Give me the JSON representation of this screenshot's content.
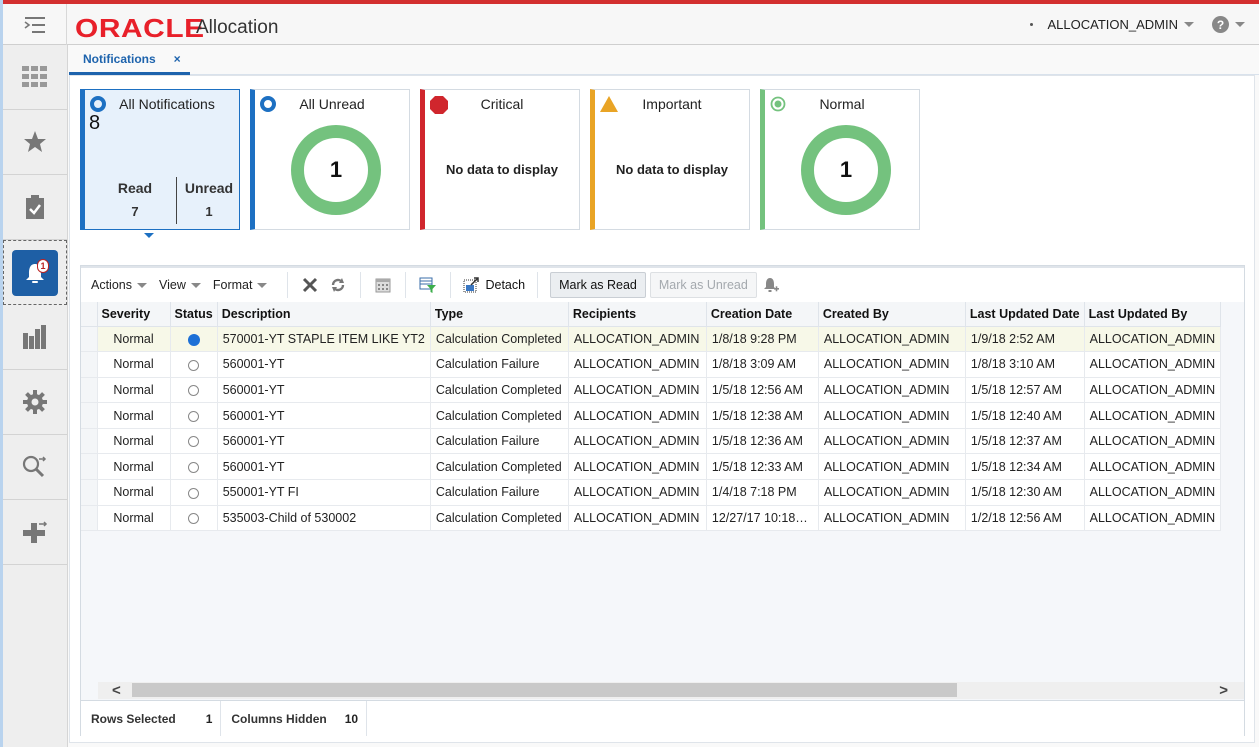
{
  "header": {
    "logo": "ORACLE",
    "app_name": "Allocation",
    "user": "ALLOCATION_ADMIN",
    "help_glyph": "?"
  },
  "leftnav": {
    "items": [
      {
        "name": "tasks-grid-icon"
      },
      {
        "name": "favorites-star-icon"
      },
      {
        "name": "clipboard-check-icon"
      },
      {
        "name": "notifications-bell-icon",
        "badge": "1",
        "active": true
      },
      {
        "name": "reports-bar-chart-icon"
      },
      {
        "name": "settings-gear-icon"
      },
      {
        "name": "search-navigate-icon"
      },
      {
        "name": "create-new-icon"
      }
    ]
  },
  "tabs": [
    {
      "label": "Notifications",
      "close": "×"
    }
  ],
  "tiles": {
    "all_notifications": {
      "title": "All Notifications",
      "count": "8",
      "read_label": "Read",
      "read_value": "7",
      "unread_label": "Unread",
      "unread_value": "1"
    },
    "all_unread": {
      "title": "All Unread",
      "value": "1"
    },
    "critical": {
      "title": "Critical",
      "message": "No data to display",
      "color": "#d0262d"
    },
    "important": {
      "title": "Important",
      "message": "No data to display",
      "color": "#e9a425"
    },
    "normal": {
      "title": "Normal",
      "value": "1",
      "color": "#74c27e"
    }
  },
  "toolbar": {
    "actions": "Actions",
    "view": "View",
    "format": "Format",
    "detach": "Detach",
    "mark_read": "Mark as Read",
    "mark_unread": "Mark as Unread"
  },
  "table": {
    "columns": [
      "Severity",
      "Status",
      "Description",
      "Type",
      "Recipients",
      "Creation Date",
      "Created By",
      "Last Updated Date",
      "Last Updated By"
    ],
    "rows": [
      {
        "severity": "Normal",
        "status": "unread",
        "description": "570001-YT STAPLE ITEM LIKE YT2",
        "type": "Calculation Completed",
        "recipients": "ALLOCATION_ADMIN",
        "created": "1/8/18 9:28 PM",
        "created_by": "ALLOCATION_ADMIN",
        "updated": "1/9/18 2:52 AM",
        "updated_by": "ALLOCATION_ADMIN",
        "selected": true
      },
      {
        "severity": "Normal",
        "status": "read",
        "description": "560001-YT",
        "type": "Calculation Failure",
        "recipients": "ALLOCATION_ADMIN",
        "created": "1/8/18 3:09 AM",
        "created_by": "ALLOCATION_ADMIN",
        "updated": "1/8/18 3:10 AM",
        "updated_by": "ALLOCATION_ADMIN"
      },
      {
        "severity": "Normal",
        "status": "read",
        "description": "560001-YT",
        "type": "Calculation Completed",
        "recipients": "ALLOCATION_ADMIN",
        "created": "1/5/18 12:56 AM",
        "created_by": "ALLOCATION_ADMIN",
        "updated": "1/5/18 12:57 AM",
        "updated_by": "ALLOCATION_ADMIN"
      },
      {
        "severity": "Normal",
        "status": "read",
        "description": "560001-YT",
        "type": "Calculation Completed",
        "recipients": "ALLOCATION_ADMIN",
        "created": "1/5/18 12:38 AM",
        "created_by": "ALLOCATION_ADMIN",
        "updated": "1/5/18 12:40 AM",
        "updated_by": "ALLOCATION_ADMIN"
      },
      {
        "severity": "Normal",
        "status": "read",
        "description": "560001-YT",
        "type": "Calculation Failure",
        "recipients": "ALLOCATION_ADMIN",
        "created": "1/5/18 12:36 AM",
        "created_by": "ALLOCATION_ADMIN",
        "updated": "1/5/18 12:37 AM",
        "updated_by": "ALLOCATION_ADMIN"
      },
      {
        "severity": "Normal",
        "status": "read",
        "description": "560001-YT",
        "type": "Calculation Completed",
        "recipients": "ALLOCATION_ADMIN",
        "created": "1/5/18 12:33 AM",
        "created_by": "ALLOCATION_ADMIN",
        "updated": "1/5/18 12:34 AM",
        "updated_by": "ALLOCATION_ADMIN"
      },
      {
        "severity": "Normal",
        "status": "read",
        "description": "550001-YT FI",
        "type": "Calculation Failure",
        "recipients": "ALLOCATION_ADMIN",
        "created": "1/4/18 7:18 PM",
        "created_by": "ALLOCATION_ADMIN",
        "updated": "1/5/18 12:30 AM",
        "updated_by": "ALLOCATION_ADMIN"
      },
      {
        "severity": "Normal",
        "status": "read",
        "description": "535003-Child of 530002",
        "type": "Calculation Completed",
        "recipients": "ALLOCATION_ADMIN",
        "created": "12/27/17 10:18…",
        "created_by": "ALLOCATION_ADMIN",
        "updated": "1/2/18 12:56 AM",
        "updated_by": "ALLOCATION_ADMIN"
      }
    ]
  },
  "statusbar": {
    "rows_selected_label": "Rows Selected",
    "rows_selected": "1",
    "columns_hidden_label": "Columns Hidden",
    "columns_hidden": "10"
  },
  "colors": {
    "brand_red": "#e8202a",
    "accent_blue": "#1d63ad",
    "normal_green": "#74c27e"
  }
}
